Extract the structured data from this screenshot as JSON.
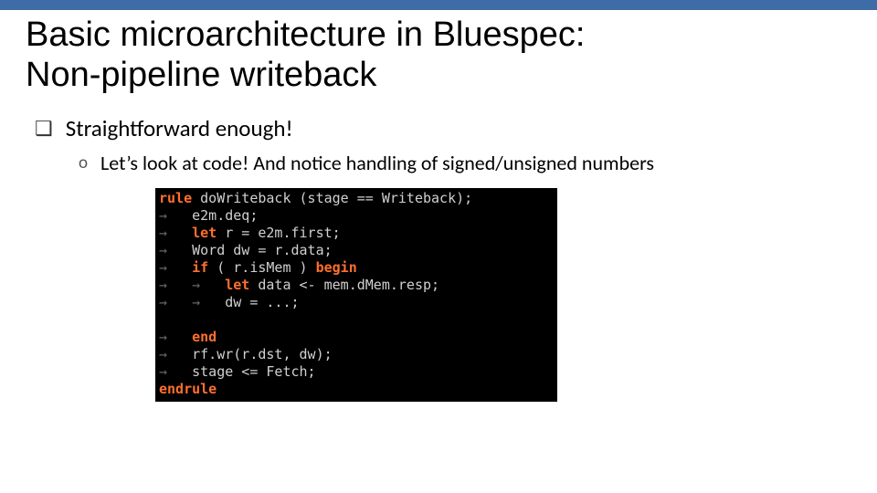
{
  "title_line1": "Basic microarchitecture in Bluespec:",
  "title_line2": "Non-pipeline writeback",
  "bullets": {
    "b1": "Straightforward enough!",
    "b2": "Let’s look at code! And notice handling of signed/unsigned numbers"
  },
  "markers": {
    "square": "❑",
    "circle": "o"
  },
  "code": {
    "arrow": "→",
    "l1_rule": "rule",
    "l1_rest": " doWriteback (stage == Writeback);",
    "l2": "   e2m.deq;",
    "l3_let": "let",
    "l3_rest": " r = e2m.first;",
    "l4": "   Word dw = r.data;",
    "l5_if": "if",
    "l5_mid": " ( r.isMem ) ",
    "l5_begin": "begin",
    "l6_let": "let",
    "l6_rest": " data <- mem.dMem.resp;",
    "l7": "   dw = ...;",
    "l8": "",
    "l9_end": "end",
    "l10": "   rf.wr(r.dst, dw);",
    "l11": "   stage <= Fetch;",
    "l12_endrule": "endrule"
  }
}
